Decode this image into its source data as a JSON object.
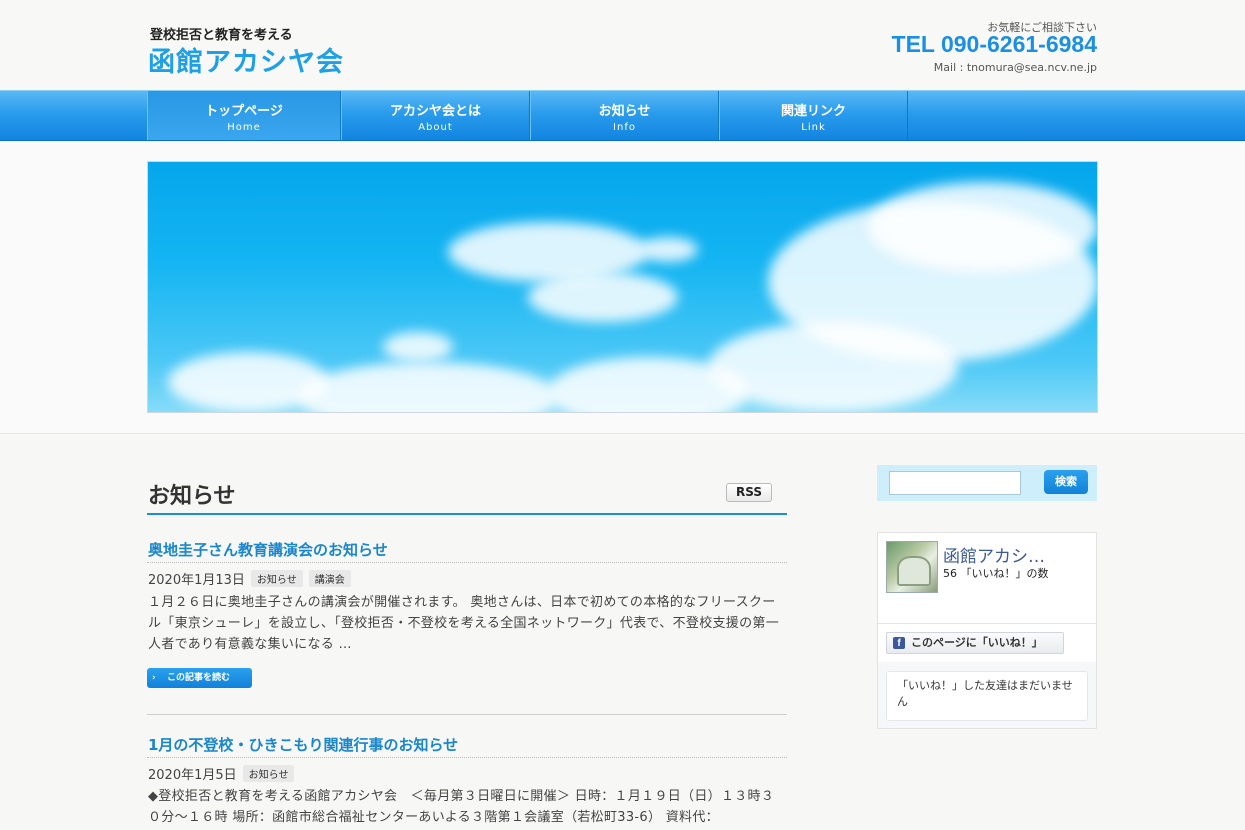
{
  "header": {
    "tagline": "登校拒否と教育を考える",
    "site_title": "函館アカシヤ会",
    "contact_lead": "お気軽にご相談下さい",
    "tel": "TEL 090-6261-6984",
    "mail": "Mail : tnomura@sea.ncv.ne.jp"
  },
  "nav": {
    "items": [
      {
        "jp": "トップページ",
        "en": "Home",
        "active": true
      },
      {
        "jp": "アカシヤ会とは",
        "en": "About"
      },
      {
        "jp": "お知らせ",
        "en": "Info"
      },
      {
        "jp": "関連リンク",
        "en": "Link"
      }
    ]
  },
  "main": {
    "section_title": "お知らせ",
    "rss_label": "RSS",
    "posts": [
      {
        "title": "奥地圭子さん教育講演会のお知らせ",
        "date": "2020年1月13日",
        "tags": [
          "お知らせ",
          "講演会"
        ],
        "body": "１月２６日に奥地圭子さんの講演会が開催されます。 奥地さんは、日本で初めての本格的なフリースクール「東京シューレ」を設立し、「登校拒否・不登校を考える全国ネットワーク」代表で、不登校支援の第一人者であり有意義な集いになる …",
        "read_more": "この記事を読む"
      },
      {
        "title": "1月の不登校・ひきこもり関連行事のお知らせ",
        "date": "2020年1月5日",
        "tags": [
          "お知らせ"
        ],
        "body": "◆登校拒否と教育を考える函館アカシヤ会　＜毎月第３日曜日に開催＞ 日時：１月１９日（日）１３時３０分〜１６時 場所：函館市総合福祉センターあいよる３階第１会議室（若松町33-6） 資料代："
      }
    ]
  },
  "sidebar": {
    "search_placeholder": "",
    "search_button": "検索",
    "facebook": {
      "page_name": "函館アカシ…",
      "likes": "56 「いいね！」の数",
      "like_button": "このページに「いいね！」",
      "like_button_icon": "f",
      "friends_note": "「いいね！」した友達はまだいません"
    }
  },
  "colors": {
    "accent": "#1ea0e8",
    "nav": "#2a9cec",
    "facebook": "#3b5998"
  }
}
